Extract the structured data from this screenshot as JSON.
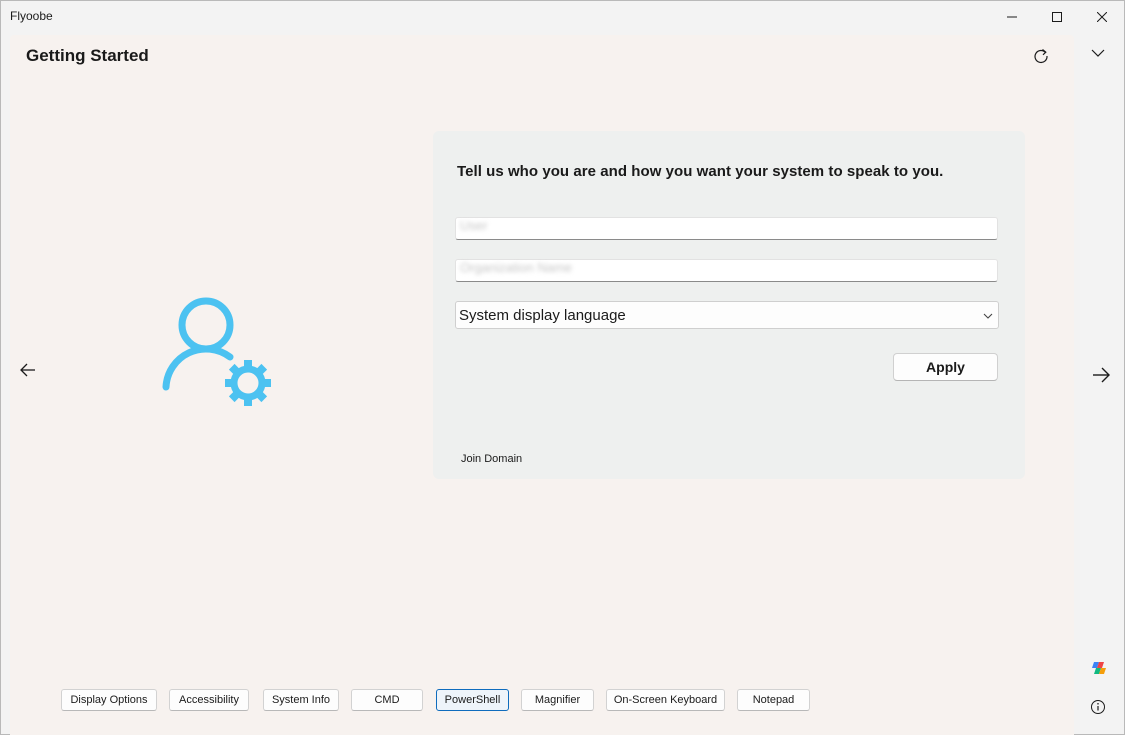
{
  "window": {
    "title": "Flyoobe"
  },
  "header": {
    "title": "Getting Started"
  },
  "panel": {
    "heading": "Tell us who you are and how you want your system to speak to you.",
    "name_field": {
      "value": "User"
    },
    "org_field": {
      "value": "Organization Name"
    },
    "language_select": {
      "selected": "System display language"
    },
    "apply_label": "Apply",
    "join_domain_label": "Join Domain"
  },
  "toolbar": {
    "items": [
      {
        "label": "Display Options"
      },
      {
        "label": "Accessibility"
      },
      {
        "label": "System Info"
      },
      {
        "label": "CMD"
      },
      {
        "label": "PowerShell"
      },
      {
        "label": "Magnifier"
      },
      {
        "label": "On-Screen Keyboard"
      },
      {
        "label": "Notepad"
      }
    ]
  },
  "icons": {
    "refresh": "refresh-icon",
    "back": "arrow-left-icon",
    "forward": "arrow-right-icon",
    "expand": "chevron-down-icon",
    "hero": "user-settings-icon",
    "copilot": "copilot-icon",
    "info": "info-icon"
  },
  "colors": {
    "accent": "#4cc2f1",
    "active_button_border": "#0f6cbd",
    "content_background": "#f7f2ef"
  }
}
